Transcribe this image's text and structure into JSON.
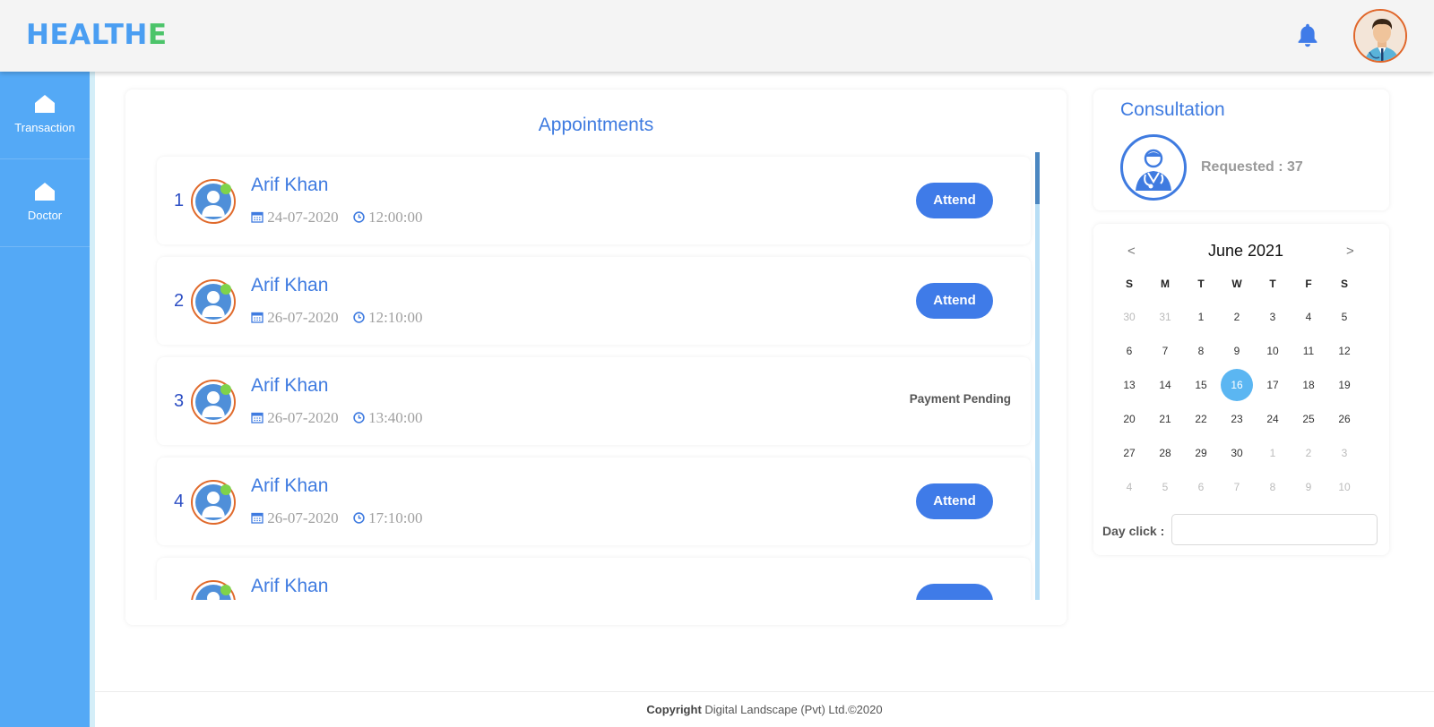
{
  "header": {
    "logo_part1": "HEALTH",
    "logo_part2": "E",
    "logo_colors": {
      "primary": "#4a9ef2",
      "accent": "#4cc46a"
    },
    "icons": [
      "bell-icon",
      "user-avatar"
    ]
  },
  "sidebar": {
    "bg_color": "#54a9f6",
    "items": [
      {
        "label": "Transaction",
        "icon": "home-icon"
      },
      {
        "label": "Doctor",
        "icon": "home-icon"
      }
    ]
  },
  "appointments": {
    "title": "Appointments",
    "rows": [
      {
        "number": "1",
        "name": "Arif Khan",
        "date": "24-07-2020",
        "time": "12:00:00",
        "action": "Attend"
      },
      {
        "number": "2",
        "name": "Arif Khan",
        "date": "26-07-2020",
        "time": "12:10:00",
        "action": "Attend"
      },
      {
        "number": "3",
        "name": "Arif Khan",
        "date": "26-07-2020",
        "time": "13:40:00",
        "status": "Payment Pending"
      },
      {
        "number": "4",
        "name": "Arif Khan",
        "date": "26-07-2020",
        "time": "17:10:00",
        "action": "Attend"
      },
      {
        "number": "",
        "name": "Arif Khan",
        "date": "",
        "time": "",
        "action": ""
      }
    ]
  },
  "consultation": {
    "title": "Consultation",
    "requested": "Requested : 37",
    "icon": "doctor-icon"
  },
  "calendar": {
    "prev": "<",
    "next": ">",
    "month_label": "June 2021",
    "weekdays": [
      "S",
      "M",
      "T",
      "W",
      "T",
      "F",
      "S"
    ],
    "weeks": [
      [
        "30",
        "31",
        "1",
        "2",
        "3",
        "4",
        "5"
      ],
      [
        "6",
        "7",
        "8",
        "9",
        "10",
        "11",
        "12"
      ],
      [
        "13",
        "14",
        "15",
        "16",
        "17",
        "18",
        "19"
      ],
      [
        "20",
        "21",
        "22",
        "23",
        "24",
        "25",
        "26"
      ],
      [
        "27",
        "28",
        "29",
        "30",
        "1",
        "2",
        "3"
      ],
      [
        "4",
        "5",
        "6",
        "7",
        "8",
        "9",
        "10"
      ]
    ],
    "selected": "16",
    "day_click_label": "Day click :",
    "day_click_value": ""
  },
  "footer": {
    "bold": "Copyright",
    "text": " Digital Landscape (Pvt) Ltd.©2020"
  }
}
